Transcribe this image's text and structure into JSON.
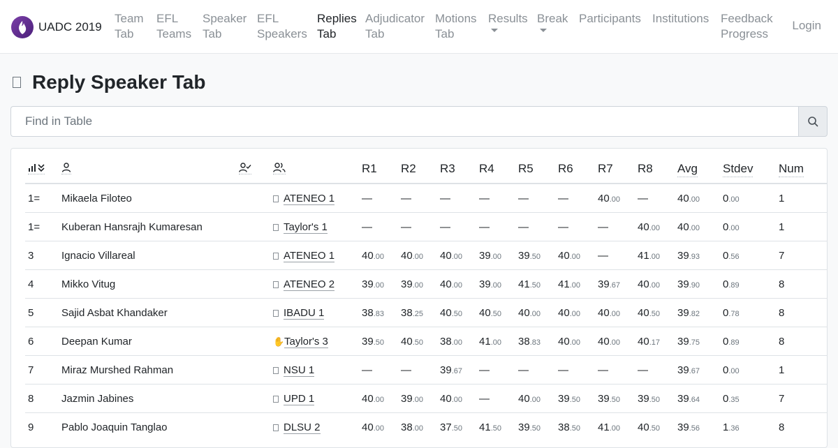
{
  "brand": {
    "name": "UADC 2019"
  },
  "nav": [
    {
      "line1": "Team",
      "line2": "Tab",
      "active": false,
      "dropdown": false
    },
    {
      "line1": "EFL",
      "line2": "Teams",
      "active": false,
      "dropdown": false
    },
    {
      "line1": "Speaker",
      "line2": "Tab",
      "active": false,
      "dropdown": false
    },
    {
      "line1": "EFL",
      "line2": "Speakers",
      "active": false,
      "dropdown": false
    },
    {
      "line1": "Replies",
      "line2": "Tab",
      "active": true,
      "dropdown": false
    },
    {
      "line1": "Adjudicator",
      "line2": "Tab",
      "active": false,
      "dropdown": false
    },
    {
      "line1": "Motions",
      "line2": "Tab",
      "active": false,
      "dropdown": false
    },
    {
      "line1": "Results",
      "line2": "",
      "active": false,
      "dropdown": true
    },
    {
      "line1": "Break",
      "line2": "",
      "active": false,
      "dropdown": true
    },
    {
      "line1": "Participants",
      "line2": "",
      "active": false,
      "dropdown": false
    },
    {
      "line1": "Institutions",
      "line2": "",
      "active": false,
      "dropdown": false
    },
    {
      "line1": "Feedback",
      "line2": "Progress",
      "active": false,
      "dropdown": false
    }
  ],
  "login_label": "Login",
  "page_title": "Reply Speaker Tab",
  "search": {
    "placeholder": "Find in Table"
  },
  "table": {
    "columns": [
      "R1",
      "R2",
      "R3",
      "R4",
      "R5",
      "R6",
      "R7",
      "R8",
      "Avg",
      "Stdev",
      "Num"
    ],
    "rows": [
      {
        "rank": "1=",
        "name": "Mikaela Filoteo",
        "team": "ATENEO 1",
        "emoji": "box",
        "scores": [
          "—",
          "—",
          "—",
          "—",
          "—",
          "—",
          "40.00",
          "—"
        ],
        "avg": "40.00",
        "stdev": "0.00",
        "num": "1"
      },
      {
        "rank": "1=",
        "name": "Kuberan Hansrajh Kumaresan",
        "team": "Taylor's 1",
        "emoji": "box",
        "scores": [
          "—",
          "—",
          "—",
          "—",
          "—",
          "—",
          "—",
          "40.00"
        ],
        "avg": "40.00",
        "stdev": "0.00",
        "num": "1"
      },
      {
        "rank": "3",
        "name": "Ignacio Villareal",
        "team": "ATENEO 1",
        "emoji": "box",
        "scores": [
          "40.00",
          "40.00",
          "40.00",
          "39.00",
          "39.50",
          "40.00",
          "—",
          "41.00"
        ],
        "avg": "39.93",
        "stdev": "0.56",
        "num": "7"
      },
      {
        "rank": "4",
        "name": "Mikko Vitug",
        "team": "ATENEO 2",
        "emoji": "box",
        "scores": [
          "39.00",
          "39.00",
          "40.00",
          "39.00",
          "41.50",
          "41.00",
          "39.67",
          "40.00"
        ],
        "avg": "39.90",
        "stdev": "0.89",
        "num": "8"
      },
      {
        "rank": "5",
        "name": "Sajid Asbat Khandaker",
        "team": "IBADU 1",
        "emoji": "box",
        "scores": [
          "38.83",
          "38.25",
          "40.50",
          "40.50",
          "40.00",
          "40.00",
          "40.00",
          "40.50"
        ],
        "avg": "39.82",
        "stdev": "0.78",
        "num": "8"
      },
      {
        "rank": "6",
        "name": "Deepan Kumar",
        "team": "Taylor's 3",
        "emoji": "hand",
        "scores": [
          "39.50",
          "40.50",
          "38.00",
          "41.00",
          "38.83",
          "40.00",
          "40.00",
          "40.17"
        ],
        "avg": "39.75",
        "stdev": "0.89",
        "num": "8"
      },
      {
        "rank": "7",
        "name": "Miraz Murshed Rahman",
        "team": "NSU 1",
        "emoji": "box",
        "scores": [
          "—",
          "—",
          "39.67",
          "—",
          "—",
          "—",
          "—",
          "—"
        ],
        "avg": "39.67",
        "stdev": "0.00",
        "num": "1"
      },
      {
        "rank": "8",
        "name": "Jazmin Jabines",
        "team": "UPD 1",
        "emoji": "box",
        "scores": [
          "40.00",
          "39.00",
          "40.00",
          "—",
          "40.00",
          "39.50",
          "39.50",
          "39.50"
        ],
        "avg": "39.64",
        "stdev": "0.35",
        "num": "7"
      },
      {
        "rank": "9",
        "name": "Pablo Joaquin Tanglao",
        "team": "DLSU 2",
        "emoji": "box",
        "scores": [
          "40.00",
          "38.00",
          "37.50",
          "41.50",
          "39.50",
          "38.50",
          "41.00",
          "40.50"
        ],
        "avg": "39.56",
        "stdev": "1.36",
        "num": "8"
      }
    ]
  },
  "icons": {
    "rank_sort": "bar-chart-sort-icon",
    "speaker": "person-icon",
    "speaker_check": "person-check-icon",
    "team": "people-icon",
    "search": "search-icon",
    "title": "box-icon"
  },
  "colors": {
    "text": "#212529",
    "muted": "#8a9096",
    "border": "#dee2e6",
    "brand": "#6a2f96"
  }
}
